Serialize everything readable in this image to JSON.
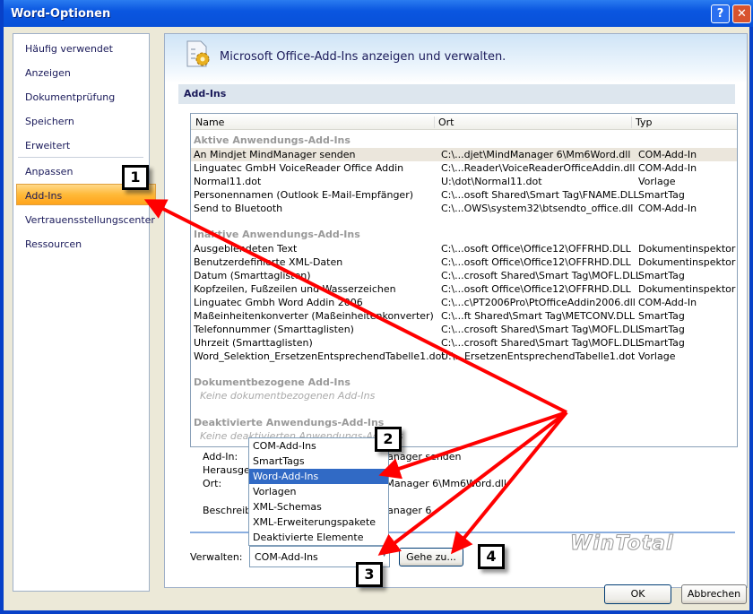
{
  "window": {
    "title": "Word-Optionen",
    "help": "?",
    "close": "✕"
  },
  "sidebar": {
    "items": [
      "Häufig verwendet",
      "Anzeigen",
      "Dokumentprüfung",
      "Speichern",
      "Erweitert",
      "Anpassen",
      "Add-Ins",
      "Vertrauensstellungscenter",
      "Ressourcen"
    ],
    "selected": "Add-Ins"
  },
  "main": {
    "header": "Microsoft Office-Add-Ins anzeigen und verwalten.",
    "section": "Add-Ins"
  },
  "list": {
    "columns": [
      "Name",
      "Ort",
      "Typ"
    ],
    "groups": [
      {
        "title": "Aktive Anwendungs-Add-Ins",
        "rows": [
          [
            "An Mindjet MindManager senden",
            "C:\\...djet\\MindManager 6\\Mm6Word.dll",
            "COM-Add-In"
          ],
          [
            "Linguatec GmbH VoiceReader Office Addin",
            "C:\\...Reader\\VoiceReaderOfficeAddin.dll",
            "COM-Add-In"
          ],
          [
            "Normal11.dot",
            "U:\\dot\\Normal11.dot",
            "Vorlage"
          ],
          [
            "Personennamen (Outlook E-Mail-Empfänger)",
            "C:\\...osoft Shared\\Smart Tag\\FNAME.DLL",
            "SmartTag"
          ],
          [
            "Send to Bluetooth",
            "C:\\...OWS\\system32\\btsendto_office.dll",
            "COM-Add-In"
          ]
        ]
      },
      {
        "title": "Inaktive Anwendungs-Add-Ins",
        "rows": [
          [
            "Ausgeblendeten Text",
            "C:\\...osoft Office\\Office12\\OFFRHD.DLL",
            "Dokumentinspektor"
          ],
          [
            "Benutzerdefinierte XML-Daten",
            "C:\\...osoft Office\\Office12\\OFFRHD.DLL",
            "Dokumentinspektor"
          ],
          [
            "Datum (Smarttaglisten)",
            "C:\\...crosoft Shared\\Smart Tag\\MOFL.DLL",
            "SmartTag"
          ],
          [
            "Kopfzeilen, Fußzeilen und Wasserzeichen",
            "C:\\...osoft Office\\Office12\\OFFRHD.DLL",
            "Dokumentinspektor"
          ],
          [
            "Linguatec Gmbh Word Addin 2006",
            "C:\\...c\\PT2006Pro\\PtOfficeAddin2006.dll",
            "COM-Add-In"
          ],
          [
            "Maßeinheitenkonverter (Maßeinheitenkonverter)",
            "C:\\...ft Shared\\Smart Tag\\METCONV.DLL",
            "SmartTag"
          ],
          [
            "Telefonnummer (Smarttaglisten)",
            "C:\\...crosoft Shared\\Smart Tag\\MOFL.DLL",
            "SmartTag"
          ],
          [
            "Uhrzeit (Smarttaglisten)",
            "C:\\...crosoft Shared\\Smart Tag\\MOFL.DLL",
            "SmartTag"
          ],
          [
            "Word_Selektion_ErsetzenEntsprechendTabelle1.dot",
            "U:\\...ErsetzenEntsprechendTabelle1.dot",
            "Vorlage"
          ]
        ]
      },
      {
        "title": "Dokumentbezogene Add-Ins",
        "none": "Keine dokumentbezogenen Add-Ins"
      },
      {
        "title": "Deaktivierte Anwendungs-Add-Ins",
        "none": "Keine deaktivierten Anwendungs-Add-Ins"
      }
    ]
  },
  "details": {
    "labels": [
      "Add-In:",
      "Herausgeber:",
      "Ort:",
      "Beschreibung:"
    ],
    "values": [
      "An Mindjet MindManager senden",
      "",
      "C:\\...Mindjet\\MindManager 6\\Mm6Word.dll",
      "An Mindjet MindManager 6"
    ]
  },
  "manage": {
    "label": "Verwalten:",
    "value": "COM-Add-Ins",
    "go": "Gehe zu...",
    "options": [
      "COM-Add-Ins",
      "SmartTags",
      "Word-Add-Ins",
      "Vorlagen",
      "XML-Schemas",
      "XML-Erweiterungspakete",
      "Deaktivierte Elemente"
    ],
    "highlighted": "Word-Add-Ins"
  },
  "buttons": {
    "ok": "OK",
    "cancel": "Abbrechen"
  },
  "callouts": [
    "1",
    "2",
    "3",
    "4"
  ],
  "watermark": "WinTotal",
  "colors": {
    "titlebar": "#0a56e0",
    "selected": "#ffb938",
    "highlight": "#316ac5",
    "arrow": "#ff0000"
  }
}
